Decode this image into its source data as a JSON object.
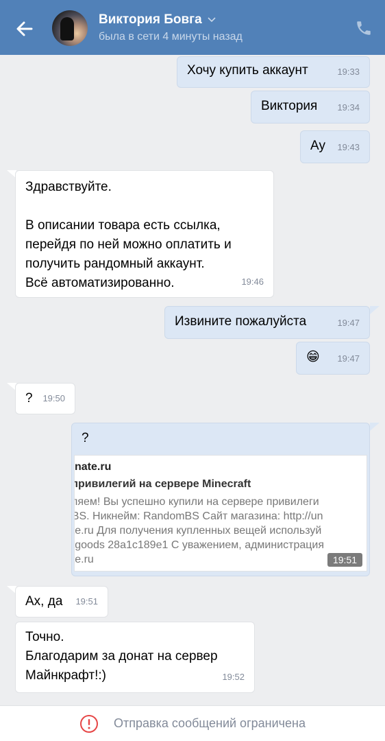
{
  "header": {
    "name": "Виктория Бовга",
    "status": "была в сети 4 минуты назад"
  },
  "messages": [
    {
      "dir": "out",
      "text": "Хочу купить аккаунт",
      "time": "19:33"
    },
    {
      "dir": "out",
      "text": "Виктория",
      "time": "19:34"
    },
    {
      "dir": "out",
      "text": "Ау",
      "time": "19:43"
    },
    {
      "dir": "in",
      "text": "Здравствуйте.\n\nВ описании товара есть ссылка,\nперейдя по ней можно оплатить и\nполучить рандомный аккаунт.\nВсё автоматизированно.",
      "time": "19:46"
    },
    {
      "dir": "out",
      "text": "Извините пожалуйста",
      "time": "19:47"
    },
    {
      "dir": "out",
      "text": "😁",
      "time": "19:47"
    },
    {
      "dir": "in",
      "text": "?",
      "time": "19:50"
    },
    {
      "dir": "out",
      "text": "?",
      "time": "19:51"
    },
    {
      "dir": "in",
      "text": "Ах, да",
      "time": "19:51"
    },
    {
      "dir": "in",
      "text": "Точно.\nБлагодарим за донат на сервер\nМайнкрафт!:)",
      "time": "19:52"
    }
  ],
  "link": {
    "domain": "nate.ru",
    "title": "ка привилегий на сервере Minecraft",
    "description": "авляем! Вы успешно купили на сервере привилеги\nm BS. Никнейм: RandomBS Сайт магазина: http://un\nnate.ru Для получения купленных вещей используй\ngetgoods 28a1c189e1 С уважением, администрация\nnate.ru",
    "time": "19:51"
  },
  "footer": {
    "text": "Отправка сообщений ограничена"
  },
  "colors": {
    "header": "#5181b8",
    "outgoing": "#dce7f5",
    "incoming": "#ffffff",
    "background": "#edeef0",
    "warning": "#e64646"
  }
}
